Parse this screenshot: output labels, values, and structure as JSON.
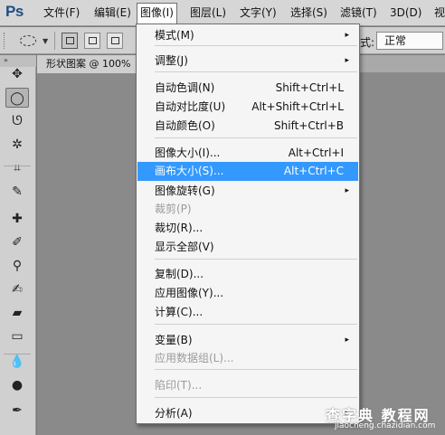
{
  "app": {
    "logo": "Ps"
  },
  "menubar": {
    "items": [
      {
        "label": "文件(F)"
      },
      {
        "label": "编辑(E)"
      },
      {
        "label": "图像(I)"
      },
      {
        "label": "图层(L)"
      },
      {
        "label": "文字(Y)"
      },
      {
        "label": "选择(S)"
      },
      {
        "label": "滤镜(T)"
      },
      {
        "label": "3D(D)"
      },
      {
        "label": "视"
      }
    ]
  },
  "options": {
    "style_label": "式:",
    "style_value": "正常"
  },
  "document": {
    "tab_title": "形状图案 @ 100%"
  },
  "toolbar": {
    "top_label": "»",
    "tools": [
      {
        "icon": "move-tool-icon",
        "glyph": "✥"
      },
      {
        "icon": "elliptical-marquee-icon",
        "glyph": "◯"
      },
      {
        "icon": "lasso-icon",
        "glyph": "ᘎ"
      },
      {
        "icon": "magic-wand-icon",
        "glyph": "✲"
      },
      {
        "icon": "crop-icon",
        "glyph": "⌗"
      },
      {
        "icon": "eyedropper-icon",
        "glyph": "✎"
      },
      {
        "icon": "healing-brush-icon",
        "glyph": "✚"
      },
      {
        "icon": "brush-icon",
        "glyph": "✐"
      },
      {
        "icon": "clone-stamp-icon",
        "glyph": "⚲"
      },
      {
        "icon": "history-brush-icon",
        "glyph": "✍"
      },
      {
        "icon": "eraser-icon",
        "glyph": "▰"
      },
      {
        "icon": "gradient-icon",
        "glyph": "▭"
      },
      {
        "icon": "blur-icon",
        "glyph": "💧"
      },
      {
        "icon": "dodge-icon",
        "glyph": "●"
      },
      {
        "icon": "pen-icon",
        "glyph": "✒"
      }
    ]
  },
  "image_menu": {
    "items": [
      {
        "label": "模式(M)",
        "shortcut": "",
        "submenu": "▸"
      },
      {
        "label": "调整(J)",
        "shortcut": "",
        "submenu": "▸"
      },
      {
        "label": "自动色调(N)",
        "shortcut": "Shift+Ctrl+L"
      },
      {
        "label": "自动对比度(U)",
        "shortcut": "Alt+Shift+Ctrl+L"
      },
      {
        "label": "自动颜色(O)",
        "shortcut": "Shift+Ctrl+B"
      },
      {
        "label": "图像大小(I)...",
        "shortcut": "Alt+Ctrl+I"
      },
      {
        "label": "画布大小(S)...",
        "shortcut": "Alt+Ctrl+C"
      },
      {
        "label": "图像旋转(G)",
        "shortcut": "",
        "submenu": "▸"
      },
      {
        "label": "裁剪(P)",
        "shortcut": ""
      },
      {
        "label": "裁切(R)...",
        "shortcut": ""
      },
      {
        "label": "显示全部(V)",
        "shortcut": ""
      },
      {
        "label": "复制(D)...",
        "shortcut": ""
      },
      {
        "label": "应用图像(Y)...",
        "shortcut": ""
      },
      {
        "label": "计算(C)...",
        "shortcut": ""
      },
      {
        "label": "变量(B)",
        "shortcut": "",
        "submenu": "▸"
      },
      {
        "label": "应用数据组(L)...",
        "shortcut": ""
      },
      {
        "label": "陷印(T)...",
        "shortcut": ""
      },
      {
        "label": "分析(A)",
        "shortcut": "",
        "submenu": "▸"
      }
    ]
  },
  "watermark": {
    "main": "查字典 教程网",
    "sub": "jiaocheng.chazidian.com"
  },
  "colors": {
    "highlight": "#3399ff",
    "disabled_text": "#9b9b9b",
    "logo": "#1d4f85"
  }
}
